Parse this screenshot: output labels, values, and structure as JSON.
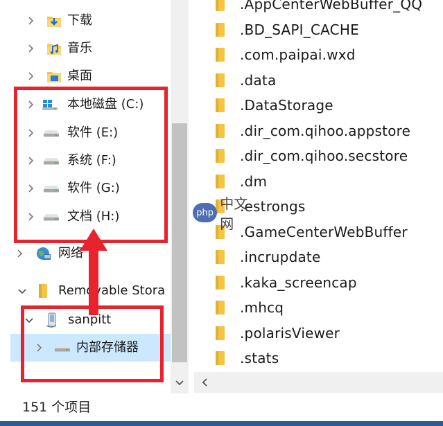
{
  "nav": {
    "items": [
      {
        "label": "下载",
        "icon": "downloads-folder-icon",
        "expand": "right"
      },
      {
        "label": "音乐",
        "icon": "music-folder-icon",
        "expand": "right"
      },
      {
        "label": "桌面",
        "icon": "desktop-folder-icon",
        "expand": "right"
      },
      {
        "label": "本地磁盘 (C:)",
        "icon": "windows-drive-icon",
        "expand": "right"
      },
      {
        "label": "软件 (E:)",
        "icon": "drive-icon",
        "expand": "right"
      },
      {
        "label": "系统 (F:)",
        "icon": "drive-icon",
        "expand": "right"
      },
      {
        "label": "软件 (G:)",
        "icon": "drive-icon",
        "expand": "right"
      },
      {
        "label": "文档 (H:)",
        "icon": "drive-icon",
        "expand": "right"
      },
      {
        "label": "网络",
        "icon": "network-icon",
        "expand": "right"
      },
      {
        "label": "Removable Stora",
        "icon": "folder-icon",
        "expand": "down"
      },
      {
        "label": "sanpitt",
        "icon": "phone-icon",
        "expand": "down"
      },
      {
        "label": "内部存储器",
        "icon": "drive-icon",
        "expand": "right",
        "selected": true
      }
    ]
  },
  "files": {
    "items": [
      ".AppCenterWebBuffer_QQ",
      ".BD_SAPI_CACHE",
      ".com.paipai.wxd",
      ".data",
      ".DataStorage",
      ".dir_com.qihoo.appstore",
      ".dir_com.qihoo.secstore",
      ".dm",
      ".estrongs",
      ".GameCenterWebBuffer",
      ".incrupdate",
      ".kaka_screencap",
      ".mhcq",
      ".polarisViewer",
      ".stats",
      ""
    ]
  },
  "status": {
    "item_count": "151 个项目"
  },
  "watermark": {
    "badge": "php",
    "text": "中文网"
  },
  "colors": {
    "annotation_red": "#e8232d",
    "selection_blue": "#cce8ff",
    "folder_yellow": "#f4c543"
  }
}
